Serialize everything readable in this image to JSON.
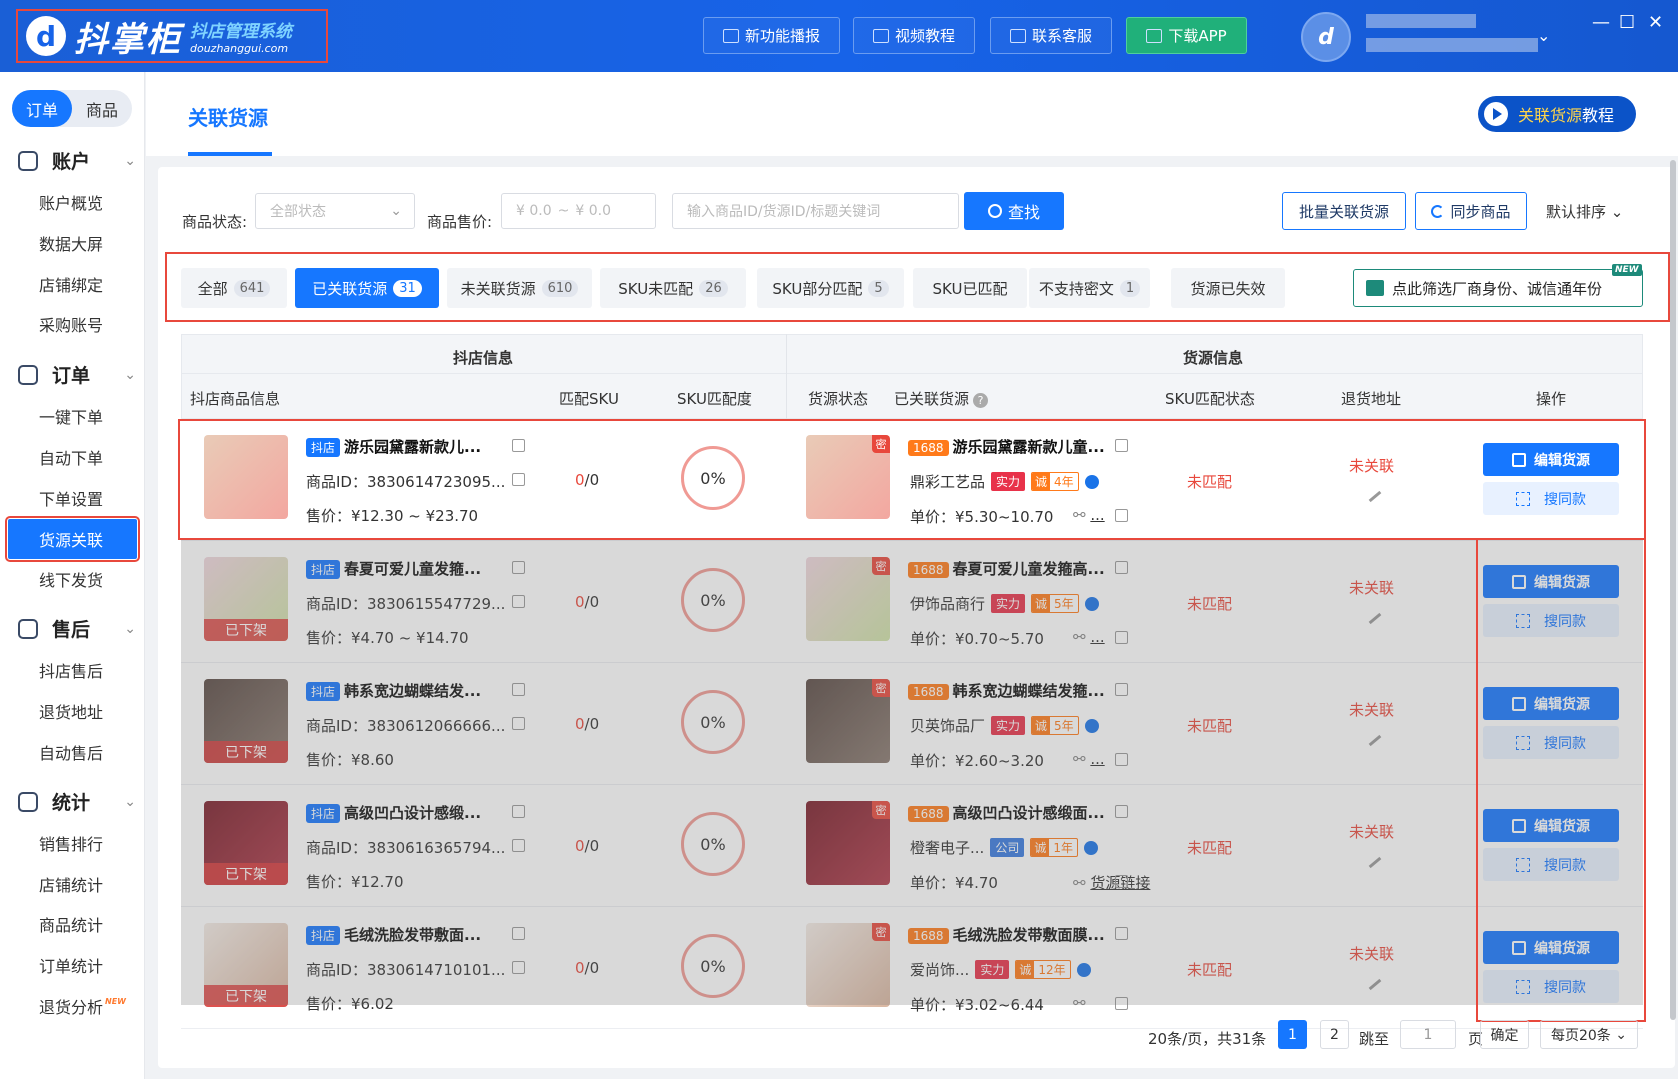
{
  "header": {
    "logo_mark": "d",
    "logo_name": "抖掌柜",
    "logo_tagline": "抖店管理系统",
    "logo_domain": "douzhanggui.com",
    "buttons": [
      "新功能播报",
      "视频教程",
      "联系客服",
      "下载APP"
    ],
    "avatar_initial": "d",
    "window_controls": [
      "—",
      "☐",
      "✕"
    ]
  },
  "sidebar": {
    "segment": [
      "订单",
      "商品"
    ],
    "groups": [
      {
        "label": "账户",
        "items": [
          "账户概览",
          "数据大屏",
          "店铺绑定",
          "采购账号"
        ]
      },
      {
        "label": "订单",
        "items": [
          "一键下单",
          "自动下单",
          "下单设置",
          "货源关联",
          "线下发货"
        ]
      },
      {
        "label": "售后",
        "items": [
          "抖店售后",
          "退货地址",
          "自动售后"
        ]
      },
      {
        "label": "统计",
        "items": [
          "销售排行",
          "店铺统计",
          "商品统计",
          "订单统计",
          "退货分析"
        ]
      }
    ],
    "new_badge": "NEW"
  },
  "page": {
    "title": "关联货源",
    "tutorial_prefix": "关联货源",
    "tutorial_suffix": "教程"
  },
  "filters": {
    "status_label": "商品状态:",
    "status_value": "全部状态",
    "price_label": "商品售价:",
    "price_from": "¥    0.0",
    "price_sep": "~",
    "price_to": "¥    0.0",
    "search_placeholder": "输入商品ID/货源ID/标题关键词",
    "search_button": "查找",
    "batch_button": "批量关联货源",
    "sync_button": "同步商品",
    "sort_label": "默认排序"
  },
  "tabs": [
    {
      "label": "全部",
      "count": "641"
    },
    {
      "label": "已关联货源",
      "count": "31"
    },
    {
      "label": "未关联货源",
      "count": "610"
    },
    {
      "label": "SKU未匹配",
      "count": "26"
    },
    {
      "label": "SKU部分匹配",
      "count": "5"
    },
    {
      "label": "SKU已匹配",
      "count": ""
    },
    {
      "label": "不支持密文",
      "count": "1"
    },
    {
      "label": "货源已失效",
      "count": ""
    }
  ],
  "filter_button": "点此筛选厂商身份、诚信通年份",
  "filter_new": "NEW",
  "table": {
    "group_left": "抖店信息",
    "group_right": "货源信息",
    "cols": [
      "抖店商品信息",
      "匹配SKU",
      "SKU匹配度",
      "货源状态",
      "已关联货源",
      "SKU匹配状态",
      "退货地址",
      "操作"
    ],
    "help_icon": "?",
    "shop_tag": "抖店",
    "src_tag": "1688",
    "secret_tag": "密",
    "id_prefix": "商品ID：",
    "price_prefix": "售价：",
    "unit_prefix": "单价：",
    "strength_badge": "实力",
    "company_badge": "公司",
    "cheng_badge": "诚",
    "offshelf": "已下架",
    "unmatched": "未匹配",
    "unlinked": "未关联",
    "edit_btn": "编辑货源",
    "same_btn": "搜同款",
    "rows": [
      {
        "title": "游乐园黛露新款儿...",
        "id": "3830614723095...",
        "price": "¥12.30 ~ ¥23.70",
        "sku_done": "0",
        "sku_total": "/0",
        "match": "0%",
        "src_title": "游乐园黛露新款儿童...",
        "supplier": "鼎彩工艺品",
        "badge": "实力",
        "years": "4年",
        "unit": "¥5.30~10.70",
        "link": "...",
        "offshelf": false
      },
      {
        "title": "春夏可爱儿童发箍...",
        "id": "3830615547729...",
        "price": "¥4.70 ~ ¥14.70",
        "sku_done": "0",
        "sku_total": "/0",
        "match": "0%",
        "src_title": "春夏可爱儿童发箍高...",
        "supplier": "伊饰品商行",
        "badge": "实力",
        "years": "5年",
        "unit": "¥0.70~5.70",
        "link": "...",
        "offshelf": true
      },
      {
        "title": "韩系宽边蝴蝶结发...",
        "id": "3830612066666...",
        "price": "¥8.60",
        "sku_done": "0",
        "sku_total": "/0",
        "match": "0%",
        "src_title": "韩系宽边蝴蝶结发箍...",
        "supplier": "贝英饰品厂",
        "badge": "实力",
        "years": "5年",
        "unit": "¥2.60~3.20",
        "link": "...",
        "offshelf": true
      },
      {
        "title": "高级凹凸设计感缎...",
        "id": "3830616365794...",
        "price": "¥12.70",
        "sku_done": "0",
        "sku_total": "/0",
        "match": "0%",
        "src_title": "高级凹凸设计感缎面...",
        "supplier": "橙奢电子...",
        "badge": "公司",
        "years": "1年",
        "unit": "¥4.70",
        "link": "货源链接",
        "offshelf": true
      },
      {
        "title": "毛绒洗脸发带敷面...",
        "id": "3830614710101...",
        "price": "¥6.02",
        "sku_done": "0",
        "sku_total": "/0",
        "match": "0%",
        "src_title": "毛绒洗脸发带敷面膜...",
        "supplier": "爱尚饰...",
        "badge": "实力",
        "years": "12年",
        "unit": "¥3.02~6.44",
        "link": "",
        "offshelf": true
      }
    ]
  },
  "pager": {
    "summary": "20条/页，共31条",
    "pages": [
      "1",
      "2"
    ],
    "jump_label": "跳至",
    "jump_value": "1",
    "page_unit": "页",
    "confirm": "确定",
    "per_page": "每页20条"
  },
  "colors": {
    "brand": "#1677ff",
    "header": "#1763e8",
    "alert_red": "#e8483c",
    "badge_orange": "#ff7a1a"
  }
}
